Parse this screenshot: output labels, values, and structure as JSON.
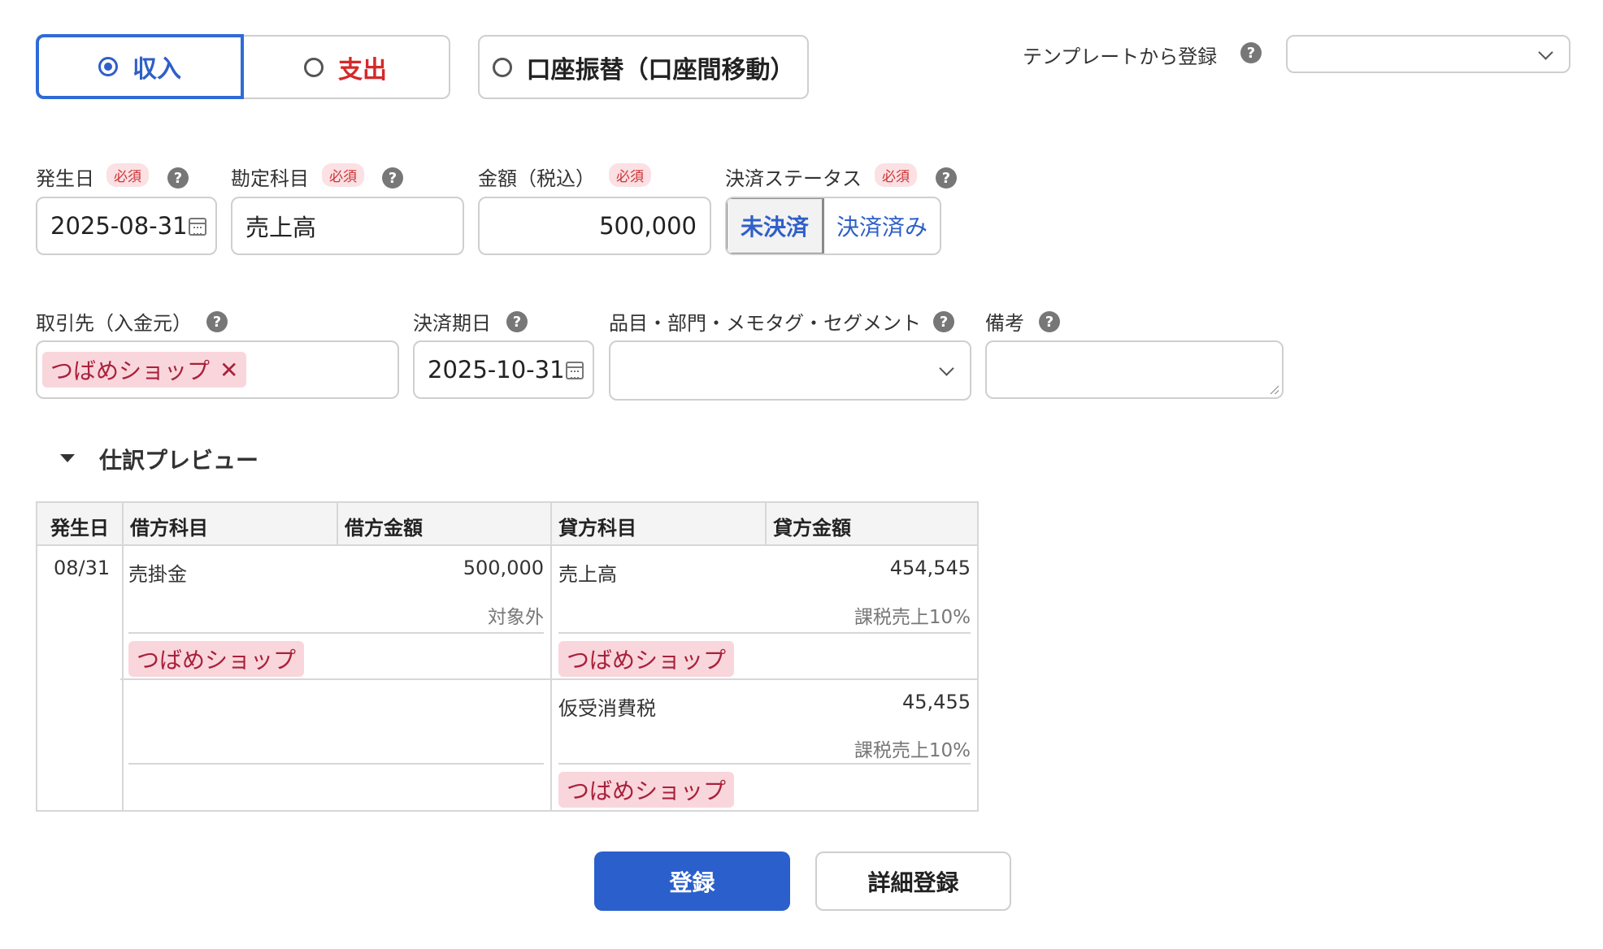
{
  "type_tabs": {
    "income": "収入",
    "expense": "支出",
    "transfer": "口座振替（口座間移動）",
    "selected": "income"
  },
  "template": {
    "label": "テンプレートから登録",
    "value": ""
  },
  "help_glyph": "?",
  "required_badge": "必須",
  "fields": {
    "date": {
      "label": "発生日",
      "value": "2025-08-31"
    },
    "account": {
      "label": "勘定科目",
      "value": "売上高"
    },
    "amount": {
      "label": "金額（税込）",
      "value": "500,000"
    },
    "status": {
      "label": "決済ステータス",
      "options": [
        "未決済",
        "決済済み"
      ],
      "selected": "未決済"
    },
    "partner": {
      "label": "取引先（入金元）",
      "tag": "つばめショップ",
      "remove_glyph": "✕"
    },
    "due_date": {
      "label": "決済期日",
      "value": "2025-10-31"
    },
    "items": {
      "label": "品目・部門・メモタグ・セグメント",
      "value": ""
    },
    "memo": {
      "label": "備考",
      "value": ""
    }
  },
  "preview": {
    "title": "仕訳プレビュー",
    "headers": [
      "発生日",
      "借方科目",
      "借方金額",
      "貸方科目",
      "貸方金額"
    ],
    "date": "08/31",
    "debit": {
      "account": "売掛金",
      "amount": "500,000",
      "tax": "対象外",
      "partner": "つばめショップ"
    },
    "credit": [
      {
        "account": "売上高",
        "amount": "454,545",
        "tax": "課税売上10%",
        "partner": "つばめショップ"
      },
      {
        "account": "仮受消費税",
        "amount": "45,455",
        "tax": "課税売上10%",
        "partner": "つばめショップ"
      }
    ]
  },
  "actions": {
    "register": "登録",
    "detail_register": "詳細登録"
  },
  "colors": {
    "accent": "#2f5fc8",
    "expense": "#d42a2a",
    "tag_bg": "#f9d6dc",
    "tag_text": "#a8213b"
  }
}
